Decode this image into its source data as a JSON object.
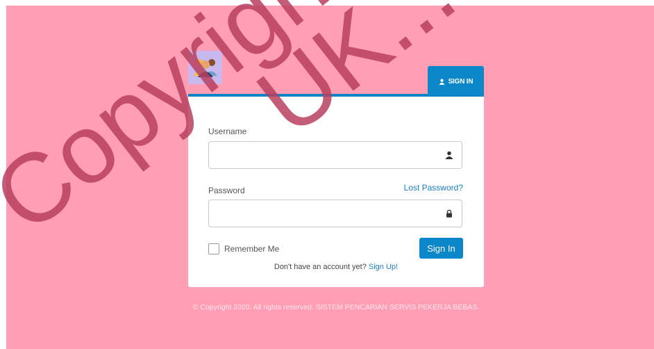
{
  "login": {
    "tab_label": "SIGN IN",
    "username_label": "Username",
    "username_value": "",
    "password_label": "Password",
    "password_value": "",
    "lost_password": "Lost Password?",
    "remember_label": "Remember Me",
    "remember_checked": false,
    "submit_label": "Sign In",
    "signup_prompt": "Don't have an account yet?",
    "signup_link": "Sign Up!"
  },
  "footer": {
    "copyright": "© Copyright 2020. All rights reserved. SISTEM PENCARIAN SERVIS PEKERJA BEBAS."
  },
  "watermark": {
    "text_left": "Copyright",
    "text_right": "UK..."
  },
  "icons": {
    "logo": "people-group-icon",
    "tab": "user-icon",
    "username": "user-icon",
    "password": "lock-icon"
  },
  "colors": {
    "background": "#ff9eb5",
    "primary": "#0a86c9",
    "link": "#1a7fc4",
    "watermark": "#b9405f"
  }
}
